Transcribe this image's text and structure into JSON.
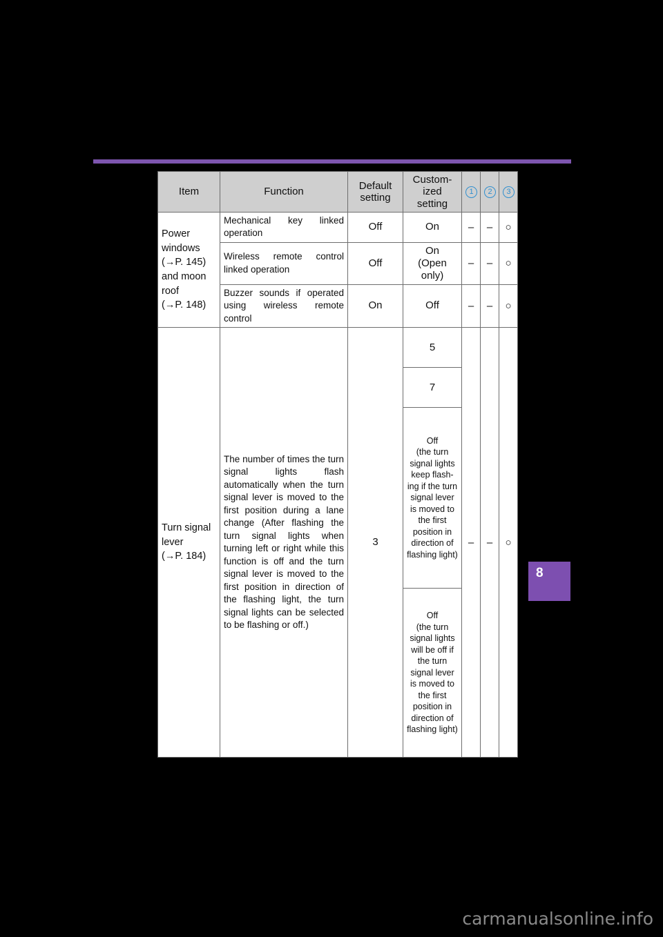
{
  "page": {
    "chapter_tab": "8",
    "watermark": "carmanualsonline.info",
    "accent_purple": "#7d55ae",
    "tab_purple": "#7d4fb0",
    "circle_blue": "#2f8fcf",
    "header_fill": "#cfcfcf"
  },
  "table": {
    "headers": {
      "item": "Item",
      "function": "Function",
      "default_setting": "Default\nsetting",
      "default_setting_line1": "Default",
      "default_setting_line2": "setting",
      "customized_setting_line1": "Custom-",
      "customized_setting_line2": "ized setting",
      "col1": "1",
      "col2": "2",
      "col3": "3"
    },
    "groups": [
      {
        "item": "Power windows\n(→P. 145)\nand moon roof\n(→P. 148)",
        "item_line1": "Power",
        "item_line2": "windows",
        "item_line3": "(→P. 145)",
        "item_line4": "and moon",
        "item_line5": "roof",
        "item_line6": "(→P. 148)",
        "rows": [
          {
            "function": "Mechanical key linked operation",
            "default": "Off",
            "customized": "On",
            "mark1": "–",
            "mark2": "–",
            "mark3": "○"
          },
          {
            "function": "Wireless remote control linked operation",
            "default": "Off",
            "customized": "On\n(Open only)",
            "customized_line1": "On",
            "customized_line2": "(Open",
            "customized_line3": "only)",
            "mark1": "–",
            "mark2": "–",
            "mark3": "○"
          },
          {
            "function": "Buzzer sounds if operated using wireless remote control",
            "default": "On",
            "customized": "Off",
            "mark1": "–",
            "mark2": "–",
            "mark3": "○"
          }
        ]
      },
      {
        "item": "Turn signal lever\n(→P. 184)",
        "item_line1": "Turn signal",
        "item_line2": "lever",
        "item_line3": "(→P. 184)",
        "function": "The number of times the turn signal lights flash automatically when the turn signal lever is moved to the first position during a lane change",
        "function_note": " (After flashing the turn signal lights when turning left or right while this function is off and the turn signal lever is moved to the first position in direction of the flashing light, the turn signal lights can be selected to be flashing or off.)",
        "default": "3",
        "mark1": "–",
        "mark2": "–",
        "mark3": "○",
        "customized_options": [
          "5",
          "7",
          "Off\n(the turn signal lights keep flashing if the turn signal lever is moved to the first position in direction of flashing light)",
          "Off\n(the turn signal lights will be off if the turn signal lever is moved to the first position in direction of flashing light)"
        ],
        "customized_option_1": "5",
        "customized_option_2": "7",
        "customized_option_3_head": "Off",
        "customized_option_3_body": "(the turn signal lights keep flash-ing if the turn signal lever is moved to the first position in direction of flashing light)",
        "customized_option_4_head": "Off",
        "customized_option_4_body": "(the turn signal lights will be off if the turn signal lever is moved to the first position in direction of flashing light)"
      }
    ]
  }
}
